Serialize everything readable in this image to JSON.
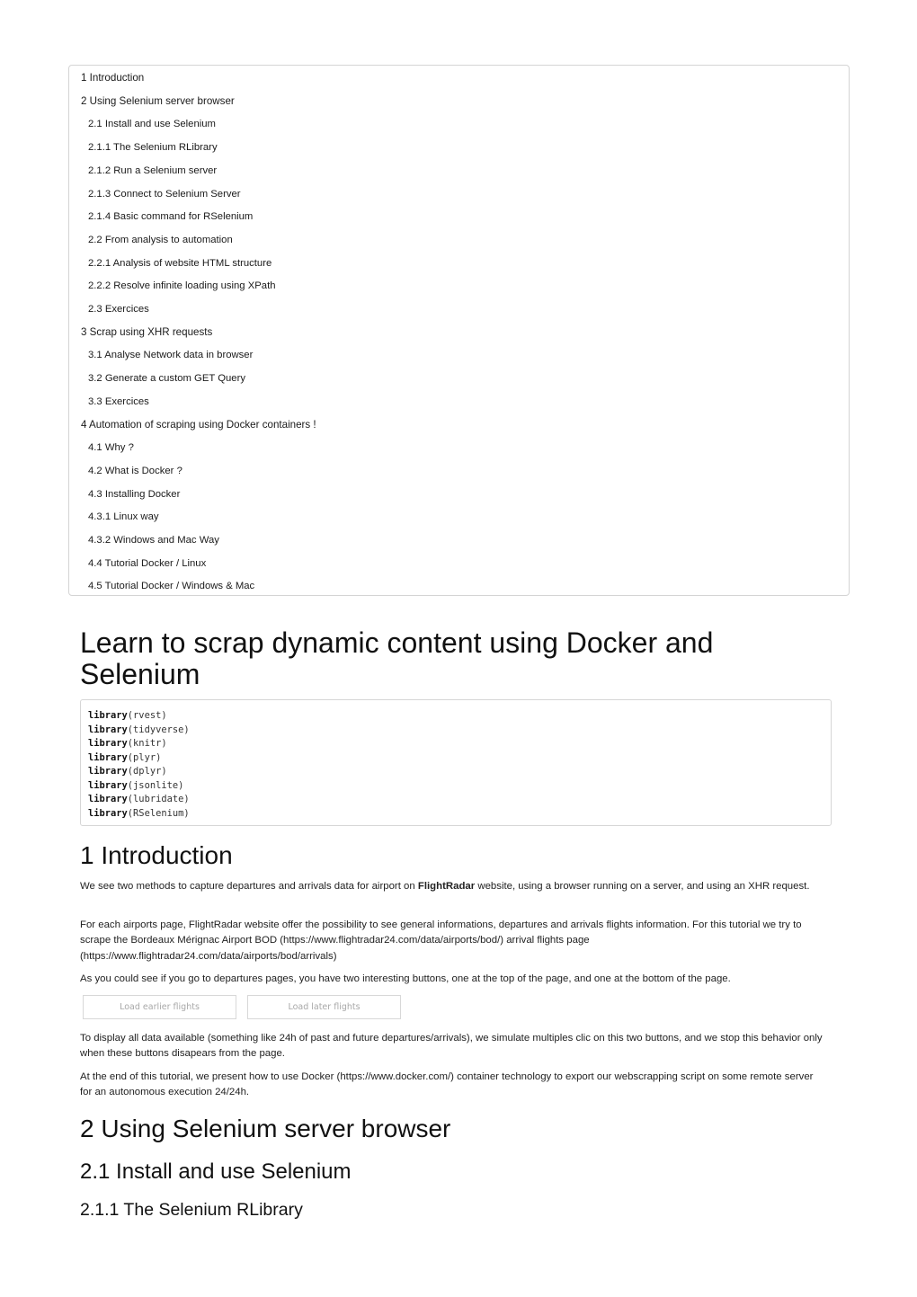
{
  "toc": {
    "items": [
      {
        "label": "1 Introduction",
        "level": 1
      },
      {
        "label": "2 Using Selenium server browser",
        "level": 1
      },
      {
        "label": "2.1 Install and use Selenium",
        "level": 2
      },
      {
        "label": "2.1.1 The Selenium RLibrary",
        "level": 2
      },
      {
        "label": "2.1.2 Run a Selenium server",
        "level": 2
      },
      {
        "label": "2.1.3 Connect to Selenium Server",
        "level": 2
      },
      {
        "label": "2.1.4 Basic command for RSelenium",
        "level": 2
      },
      {
        "label": "2.2 From analysis to automation",
        "level": 2
      },
      {
        "label": "2.2.1 Analysis of website HTML structure",
        "level": 2
      },
      {
        "label": "2.2.2 Resolve infinite loading using XPath",
        "level": 2
      },
      {
        "label": "2.3 Exercices",
        "level": 2
      },
      {
        "label": "3 Scrap using XHR requests",
        "level": 1
      },
      {
        "label": "3.1 Analyse Network data in browser",
        "level": 2
      },
      {
        "label": "3.2 Generate a custom GET Query",
        "level": 2
      },
      {
        "label": "3.3 Exercices",
        "level": 2
      },
      {
        "label": "4 Automation of scraping using Docker containers !",
        "level": 1
      },
      {
        "label": "4.1 Why ?",
        "level": 2
      },
      {
        "label": "4.2 What is Docker ?",
        "level": 2
      },
      {
        "label": "4.3 Installing Docker",
        "level": 2
      },
      {
        "label": "4.3.1 Linux way",
        "level": 2
      },
      {
        "label": "4.3.2 Windows and Mac Way",
        "level": 2
      },
      {
        "label": "4.4 Tutorial Docker / Linux",
        "level": 2
      },
      {
        "label": "4.5 Tutorial Docker / Windows & Mac",
        "level": 2
      }
    ]
  },
  "title": "Learn to scrap dynamic content using Docker and Selenium",
  "code": {
    "keyword": "library",
    "lines": [
      "(rvest)",
      "(tidyverse)",
      "(knitr)",
      "(plyr)",
      "(dplyr)",
      "(jsonlite)",
      "(lubridate)",
      "(RSelenium)"
    ]
  },
  "sections": {
    "intro_heading": "1 Introduction",
    "p1_before": "We see two methods to capture departures and arrivals data for airport on ",
    "p1_bold": "FlightRadar",
    "p1_after": " website, using a browser running on a server, and using an XHR request.",
    "p2": "For each airports page, FlightRadar website offer the possibility to see general informations, departures and arrivals flights information. For this tutorial we try to scrape the Bordeaux Mérignac Airport BOD (https://www.flightradar24.com/data/airports/bod/) arrival flights page (https://www.flightradar24.com/data/airports/bod/arrivals)",
    "p3": "As you could see if you go to departures pages, you have two interesting buttons, one at the top of the page, and one at the bottom of the page.",
    "button_earlier": "Load earlier flights",
    "button_later": "Load later flights",
    "p4": "To display all data available (something like 24h of past and future departures/arrivals), we simulate multiples clic on this two buttons, and we stop this behavior only when these buttons disapears from the page.",
    "p5": "At the end of this tutorial, we present how to use Docker (https://www.docker.com/) container technology to export our webscrapping script on some remote server for an autonomous execution 24/24h.",
    "using_heading": "2 Using Selenium server browser",
    "install_heading": "2.1 Install and use Selenium",
    "rlib_heading": "2.1.1 The Selenium RLibrary"
  }
}
